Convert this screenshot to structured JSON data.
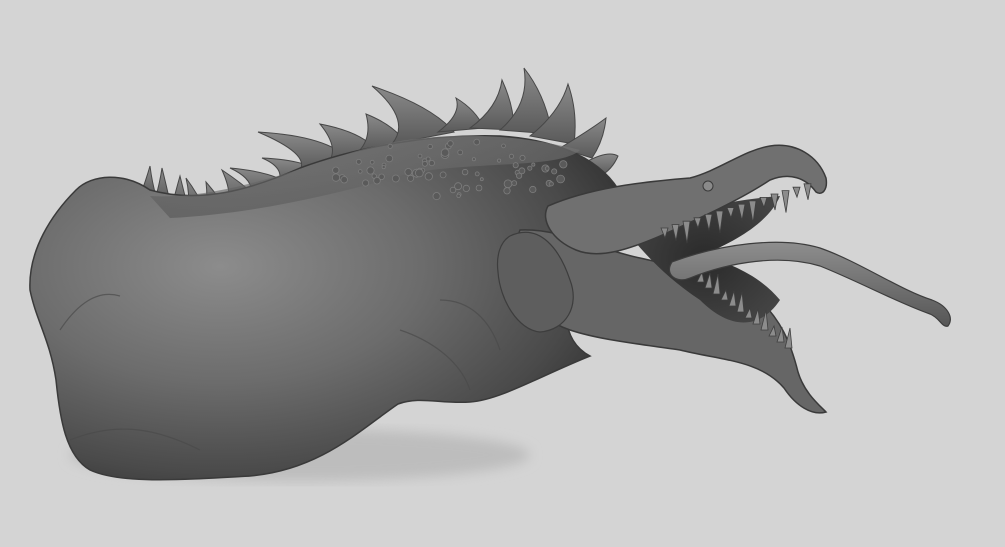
{
  "viewport": {
    "background_color": "#d4d4d4",
    "model_color": "#686868",
    "model_shadow_color": "#2e2e2e",
    "model_highlight_color": "#9a9a9a"
  },
  "model": {
    "subject": "creature-sculpt",
    "material": "matte-grey-clay"
  }
}
